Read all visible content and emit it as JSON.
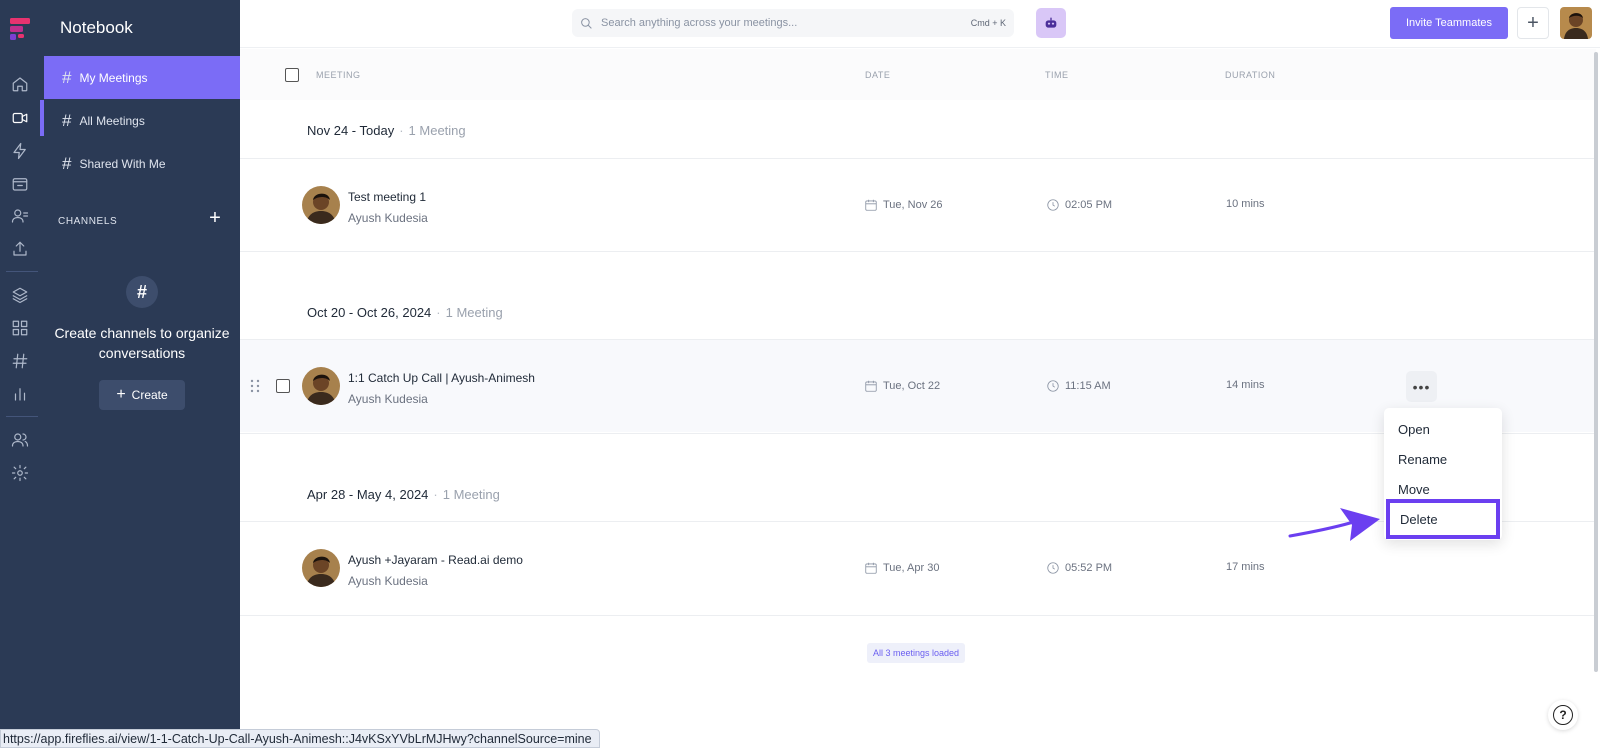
{
  "app": {
    "name": "Notebook"
  },
  "sidebar": {
    "items": [
      {
        "label": "My Meetings"
      },
      {
        "label": "All Meetings"
      },
      {
        "label": "Shared With Me"
      }
    ],
    "channels_label": "CHANNELS",
    "empty_text": "Create channels to organize conversations",
    "create_label": "Create"
  },
  "rail": {
    "icons": [
      "home-icon",
      "video-icon",
      "lightning-icon",
      "inbox-icon",
      "users-icon",
      "upload-icon",
      "layers-icon",
      "grid-icon",
      "hash-icon",
      "bar-chart-icon",
      "team-icon",
      "settings-icon"
    ],
    "active": "video-icon"
  },
  "topbar": {
    "search_placeholder": "Search anything across your meetings...",
    "search_shortcut": "Cmd + K",
    "invite_label": "Invite Teammates",
    "add_label": "+"
  },
  "table": {
    "headers": {
      "meeting": "MEETING",
      "date": "DATE",
      "time": "TIME",
      "duration": "DURATION"
    }
  },
  "groups": [
    {
      "title": "Nov 24 - Today",
      "count": "1 Meeting",
      "meetings": [
        {
          "title": "Test meeting 1",
          "host": "Ayush Kudesia",
          "date": "Tue, Nov 26",
          "time": "02:05 PM",
          "duration": "10 mins"
        }
      ]
    },
    {
      "title": "Oct 20 - Oct 26, 2024",
      "count": "1 Meeting",
      "meetings": [
        {
          "title": "1:1 Catch Up Call | Ayush-Animesh",
          "host": "Ayush Kudesia",
          "date": "Tue, Oct 22",
          "time": "11:15 AM",
          "duration": "14 mins"
        }
      ]
    },
    {
      "title": "Apr 28 - May 4, 2024",
      "count": "1 Meeting",
      "meetings": [
        {
          "title": "Ayush +Jayaram - Read.ai demo",
          "host": "Ayush Kudesia",
          "date": "Tue, Apr 30",
          "time": "05:52 PM",
          "duration": "17 mins"
        }
      ]
    }
  ],
  "context_menu": {
    "items": [
      "Open",
      "Rename",
      "Move",
      "Delete"
    ],
    "highlighted": "Delete"
  },
  "footer": {
    "loaded_text": "All 3 meetings loaded"
  },
  "status_bar": {
    "url": "https://app.fireflies.ai/view/1-1-Catch-Up-Call-Ayush-Animesh::J4vKSxYVbLrMJHwy?channelSource=mine"
  },
  "colors": {
    "sidebar_bg": "#2b3a55",
    "accent": "#7b6cf6",
    "highlight_border": "#6b3ff0"
  }
}
